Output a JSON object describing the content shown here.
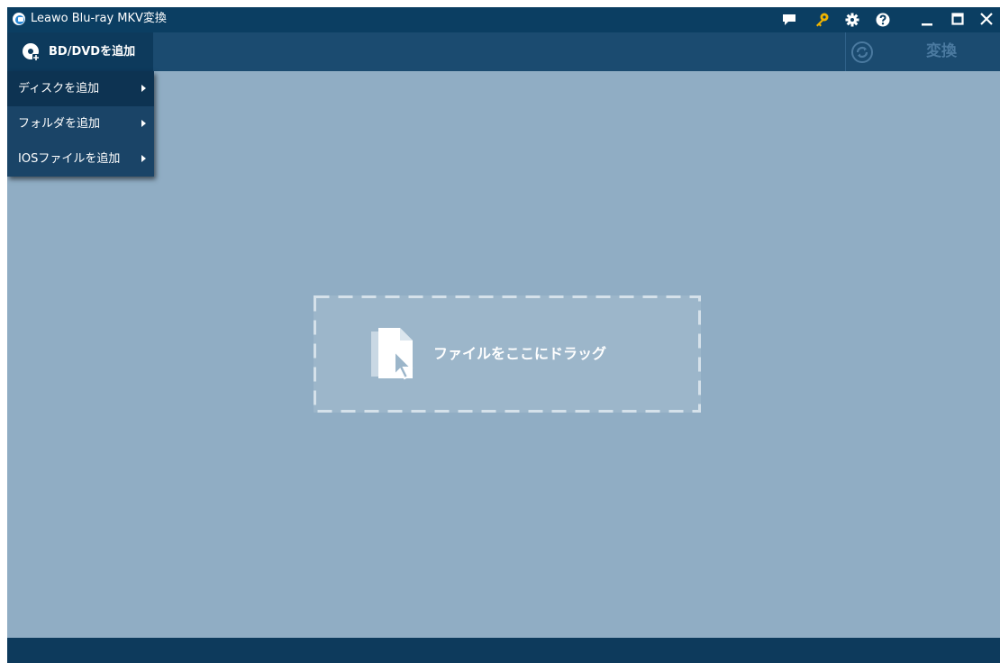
{
  "window": {
    "title": "Leawo Blu-ray MKV変換",
    "title_icons": [
      "feedback-icon",
      "key-icon",
      "gear-icon",
      "help-icon"
    ],
    "window_controls": [
      "minimize-icon",
      "maximize-icon",
      "close-icon"
    ]
  },
  "toolbar": {
    "add_button_label": "BD/DVDを追加",
    "convert_label": "変換"
  },
  "menu": {
    "items": [
      {
        "label": "ディスクを追加"
      },
      {
        "label": "フォルダを追加"
      },
      {
        "label": "IOSファイルを追加"
      }
    ]
  },
  "dropzone": {
    "text": "ファイルをここにドラッグ"
  },
  "colors": {
    "titlebar": "#0b3e62",
    "toolbar": "#1b4b70",
    "workspace": "#90adc4",
    "key_icon": "#f0b400",
    "convert_disabled": "#4b7aa0"
  }
}
